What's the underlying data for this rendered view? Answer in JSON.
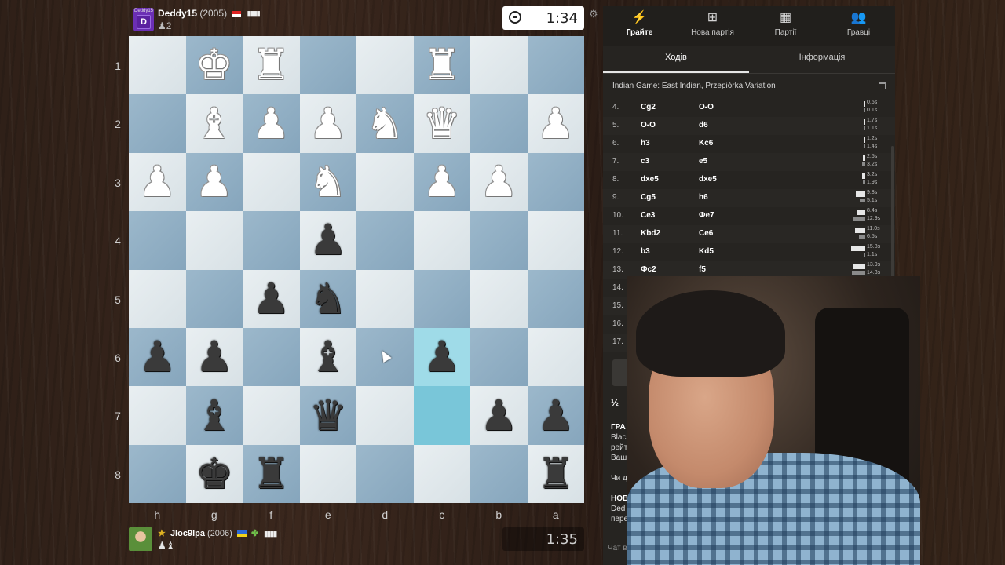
{
  "top_player": {
    "avatar_small": "Deddy15",
    "avatar_letter": "D",
    "name": "Deddy15",
    "rating": "(2005)",
    "bars": "▮▮▮▮",
    "captured": "♟2",
    "clock": "1:34"
  },
  "bottom_player": {
    "name": "Jloc9lpa",
    "rating": "(2006)",
    "bars": "▮▮▮▮",
    "captured": "♟♝",
    "clock": "1:35"
  },
  "board": {
    "orientation": "black-bottom",
    "ranks": [
      "1",
      "2",
      "3",
      "4",
      "5",
      "6",
      "7",
      "8"
    ],
    "files": [
      "h",
      "g",
      "f",
      "e",
      "d",
      "c",
      "b",
      "a"
    ],
    "highlight": [
      [
        5,
        5
      ],
      [
        6,
        5
      ]
    ],
    "pieces": [
      {
        "r": 0,
        "c": 1,
        "p": "♚",
        "side": "w"
      },
      {
        "r": 0,
        "c": 2,
        "p": "♜",
        "side": "w"
      },
      {
        "r": 0,
        "c": 5,
        "p": "♜",
        "side": "w"
      },
      {
        "r": 1,
        "c": 1,
        "p": "♝",
        "side": "w"
      },
      {
        "r": 1,
        "c": 2,
        "p": "♟",
        "side": "w"
      },
      {
        "r": 1,
        "c": 3,
        "p": "♟",
        "side": "w"
      },
      {
        "r": 1,
        "c": 4,
        "p": "♞",
        "side": "w"
      },
      {
        "r": 1,
        "c": 5,
        "p": "♛",
        "side": "w"
      },
      {
        "r": 1,
        "c": 7,
        "p": "♟",
        "side": "w"
      },
      {
        "r": 2,
        "c": 0,
        "p": "♟",
        "side": "w"
      },
      {
        "r": 2,
        "c": 1,
        "p": "♟",
        "side": "w"
      },
      {
        "r": 2,
        "c": 3,
        "p": "♞",
        "side": "w"
      },
      {
        "r": 2,
        "c": 5,
        "p": "♟",
        "side": "w"
      },
      {
        "r": 2,
        "c": 6,
        "p": "♟",
        "side": "w"
      },
      {
        "r": 3,
        "c": 3,
        "p": "♟",
        "side": "b"
      },
      {
        "r": 4,
        "c": 2,
        "p": "♟",
        "side": "b"
      },
      {
        "r": 4,
        "c": 3,
        "p": "♞",
        "side": "b"
      },
      {
        "r": 5,
        "c": 0,
        "p": "♟",
        "side": "b"
      },
      {
        "r": 5,
        "c": 1,
        "p": "♟",
        "side": "b"
      },
      {
        "r": 5,
        "c": 3,
        "p": "♝",
        "side": "b"
      },
      {
        "r": 5,
        "c": 5,
        "p": "♟",
        "side": "b"
      },
      {
        "r": 6,
        "c": 1,
        "p": "♝",
        "side": "b"
      },
      {
        "r": 6,
        "c": 3,
        "p": "♛",
        "side": "b"
      },
      {
        "r": 6,
        "c": 6,
        "p": "♟",
        "side": "b"
      },
      {
        "r": 6,
        "c": 7,
        "p": "♟",
        "side": "b"
      },
      {
        "r": 7,
        "c": 1,
        "p": "♚",
        "side": "b"
      },
      {
        "r": 7,
        "c": 2,
        "p": "♜",
        "side": "b"
      },
      {
        "r": 7,
        "c": 7,
        "p": "♜",
        "side": "b"
      }
    ]
  },
  "nav": [
    {
      "icon": "⚡",
      "label": "Грайте",
      "active": true
    },
    {
      "icon": "⊞",
      "label": "Нова партія",
      "active": false
    },
    {
      "icon": "▦",
      "label": "Партії",
      "active": false
    },
    {
      "icon": "👥",
      "label": "Гравці",
      "active": false
    }
  ],
  "tabs": {
    "moves": "Ходів",
    "info": "Інформація"
  },
  "opening": "Indian Game: East Indian, Przepiórka Variation",
  "moves": [
    {
      "n": "4.",
      "w": "Cg2",
      "b": "O-O",
      "tw": "0.5s",
      "tb": "0.1s",
      "ww": 2,
      "wb": 1
    },
    {
      "n": "5.",
      "w": "O-O",
      "b": "d6",
      "tw": "1.7s",
      "tb": "1.1s",
      "ww": 2,
      "wb": 2
    },
    {
      "n": "6.",
      "w": "h3",
      "b": "Kc6",
      "tw": "1.2s",
      "tb": "1.4s",
      "ww": 2,
      "wb": 2
    },
    {
      "n": "7.",
      "w": "c3",
      "b": "e5",
      "tw": "2.5s",
      "tb": "3.2s",
      "ww": 3,
      "wb": 4
    },
    {
      "n": "8.",
      "w": "dxe5",
      "b": "dxe5",
      "tw": "3.2s",
      "tb": "1.9s",
      "ww": 4,
      "wb": 3
    },
    {
      "n": "9.",
      "w": "Cg5",
      "b": "h6",
      "tw": "9.8s",
      "tb": "5.1s",
      "ww": 12,
      "wb": 7
    },
    {
      "n": "10.",
      "w": "Ce3",
      "b": "Фe7",
      "tw": "8.4s",
      "tb": "12.9s",
      "ww": 10,
      "wb": 16
    },
    {
      "n": "11.",
      "w": "Kbd2",
      "b": "Ce6",
      "tw": "11.0s",
      "tb": "6.5s",
      "ww": 13,
      "wb": 8
    },
    {
      "n": "12.",
      "w": "b3",
      "b": "Kd5",
      "tw": "15.8s",
      "tb": "1.1s",
      "ww": 18,
      "wb": 2
    },
    {
      "n": "13.",
      "w": "Фc2",
      "b": "f5",
      "tw": "13.9s",
      "tb": "14.3s",
      "ww": 16,
      "wb": 17
    },
    {
      "n": "14.",
      "w": "Kc4",
      "b": "",
      "tw": "30.9s",
      "tb": "9.9s",
      "ww": 26,
      "wb": 12
    },
    {
      "n": "15.",
      "w": "",
      "b": "",
      "tw": "2.6s",
      "tb": "14.4s",
      "ww": 3,
      "wb": 17
    },
    {
      "n": "16.",
      "w": "",
      "b": "",
      "tw": "7.0s",
      "tb": "28.8s",
      "ww": 9,
      "wb": 24
    },
    {
      "n": "17.",
      "w": "",
      "b": "",
      "tw": "6.6s",
      "tb": "13.9s",
      "ww": 8,
      "wb": 16
    }
  ],
  "controls": [
    "⏮",
    "◀",
    "▶",
    "⏭"
  ],
  "result": "½",
  "chat": [
    {
      "text": "ГРА ЗА",
      "bold": true
    },
    {
      "text": "Blackhis                                         ником своєї поразк",
      "bold": false
    },
    {
      "text": "рейтинго",
      "bold": false
    },
    {
      "text": "Ваш но",
      "bold": false
    },
    {
      "text": "",
      "bold": false
    },
    {
      "text": "Чи д",
      "bold": false
    },
    {
      "text": "",
      "bold": false
    },
    {
      "text": "НОВ",
      "bold": true
    },
    {
      "text": "Ded",
      "bold": false
    },
    {
      "text": "пере",
      "bold": false
    }
  ],
  "chat_placeholder": "Чат в"
}
